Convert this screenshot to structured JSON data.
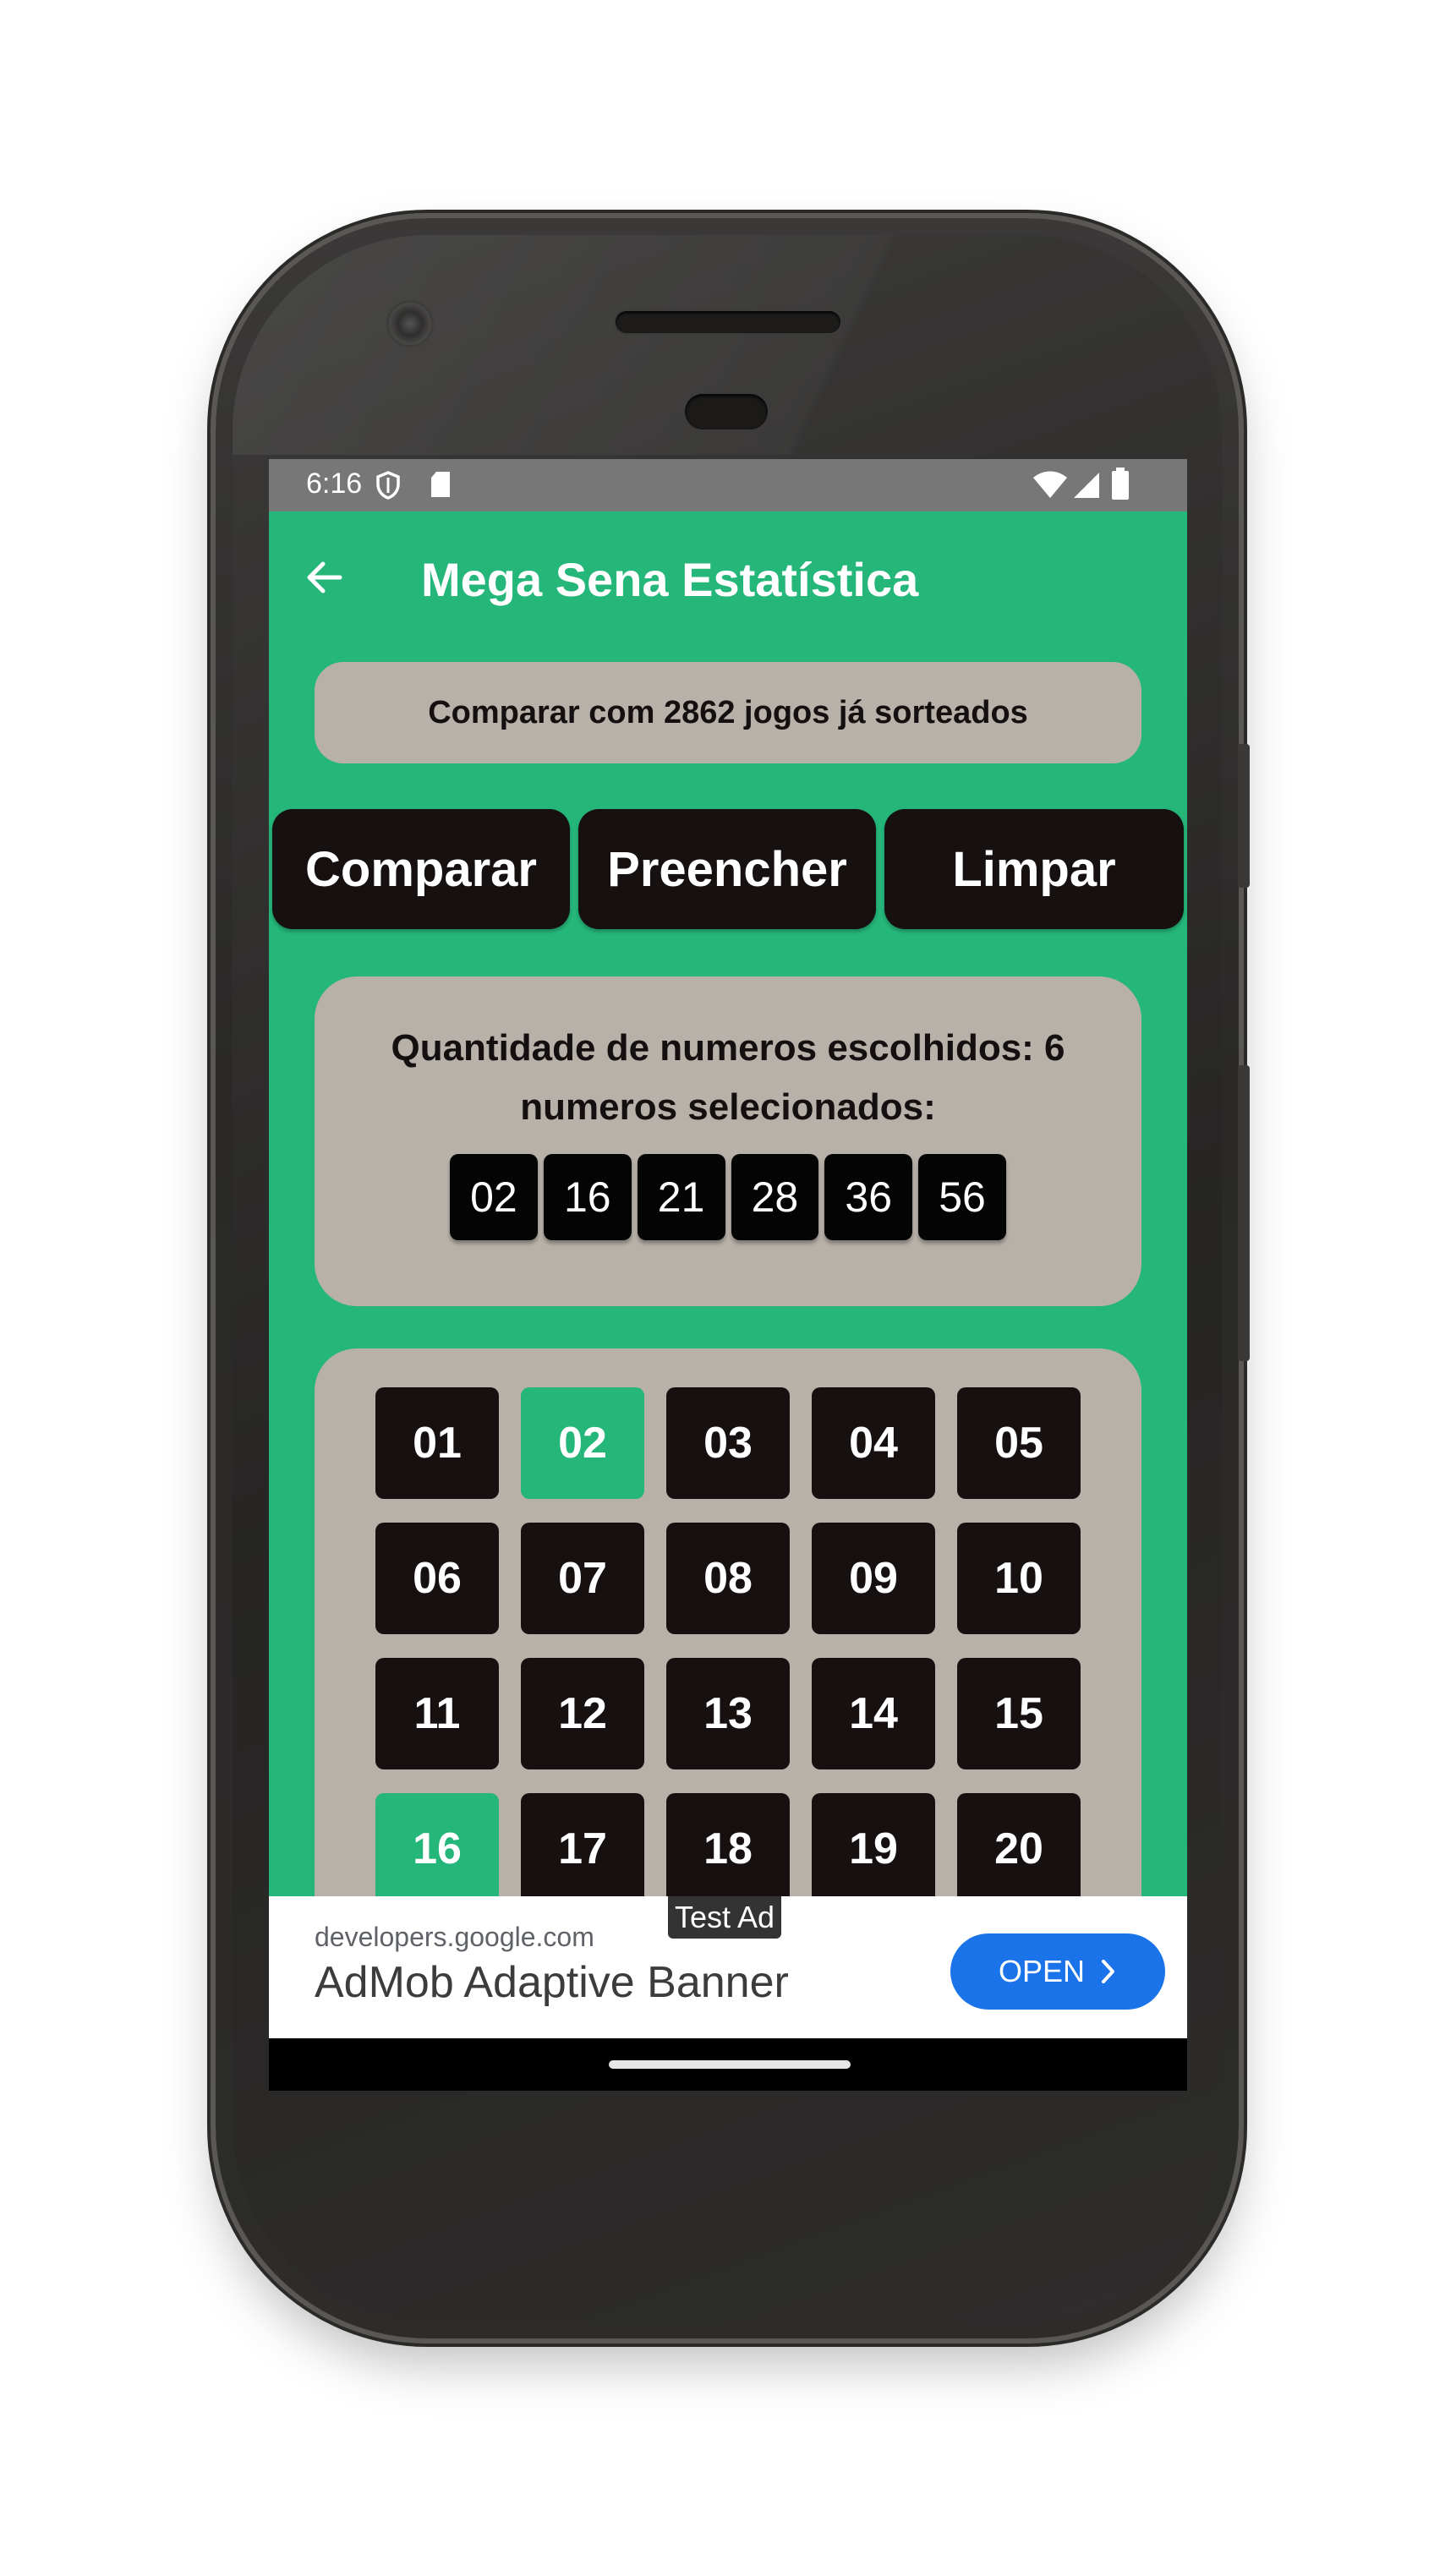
{
  "status_bar": {
    "time": "6:16"
  },
  "app_bar": {
    "title": "Mega Sena Estatística"
  },
  "compare_info": "Comparar com 2862 jogos já sorteados",
  "actions": {
    "compare": "Comparar",
    "fill": "Preencher",
    "clear": "Limpar"
  },
  "selection": {
    "count_text": "Quantidade de numeros escolhidos: 6",
    "selected_label": "numeros selecionados:",
    "numbers": [
      "02",
      "16",
      "21",
      "28",
      "36",
      "56"
    ]
  },
  "grid": {
    "numbers": [
      "01",
      "02",
      "03",
      "04",
      "05",
      "06",
      "07",
      "08",
      "09",
      "10",
      "11",
      "12",
      "13",
      "14",
      "15",
      "16",
      "17",
      "18",
      "19",
      "20"
    ],
    "selected": [
      "02",
      "16"
    ]
  },
  "ad": {
    "badge": "Test Ad",
    "domain": "developers.google.com",
    "title": "AdMob Adaptive Banner",
    "open_label": "OPEN"
  },
  "colors": {
    "accent": "#25b67a",
    "card": "#b8b1a9",
    "button": "#161010",
    "ad_button": "#1a73e8"
  }
}
